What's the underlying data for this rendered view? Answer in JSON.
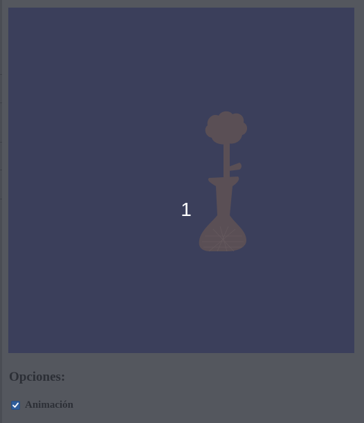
{
  "viewer": {
    "frame_number": "1",
    "background_color": "#3b3f5b",
    "model_color": "#5a4f55",
    "model_subject": "flower-in-vase-model"
  },
  "options": {
    "title": "Opciones:",
    "items": [
      {
        "label": "Animación",
        "checked": true
      }
    ]
  },
  "colors": {
    "page_background": "#54575e",
    "text": "#2c2f36",
    "checkbox_accent": "#2f5d9a"
  }
}
